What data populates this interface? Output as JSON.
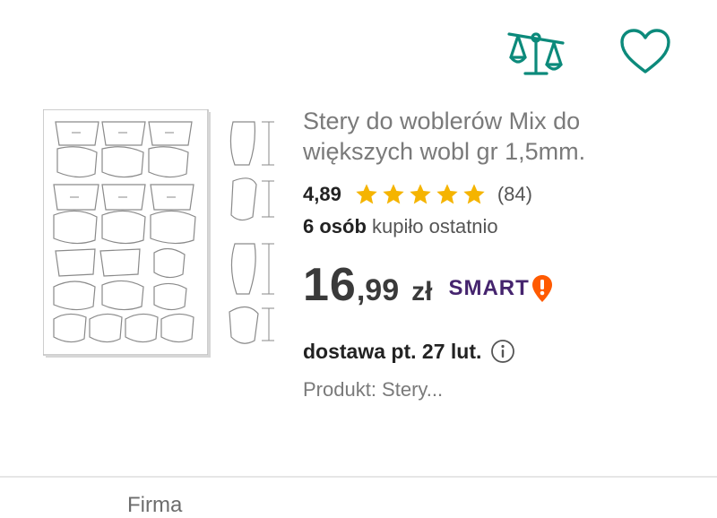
{
  "actions": {
    "compare_icon": "scales-icon",
    "favorite_icon": "heart-outline-icon",
    "accent_color": "#0c8a7b"
  },
  "listing": {
    "title": "Stery do woblerów Mix do większych wobl gr 1,5mm.",
    "image_description": "sheet of lure diving lip templates",
    "seller": "Firma",
    "rating": {
      "value": "4,89",
      "stars": 5,
      "count": "(84)",
      "star_color": "#f5b400"
    },
    "bought": {
      "count": "6 osób",
      "text": " kupiło ostatnio"
    },
    "price": {
      "integer": "16",
      "decimal": ",99",
      "currency": "zł"
    },
    "smart": {
      "text": "SMART",
      "badge_icon": "smart-exclamation-icon",
      "text_color": "#45246e",
      "badge_color": "#ff5a00"
    },
    "delivery": {
      "text": "dostawa pt. 27 lut.",
      "info_icon": "info-circle-icon"
    },
    "product": {
      "text": "Produkt: Stery..."
    }
  }
}
